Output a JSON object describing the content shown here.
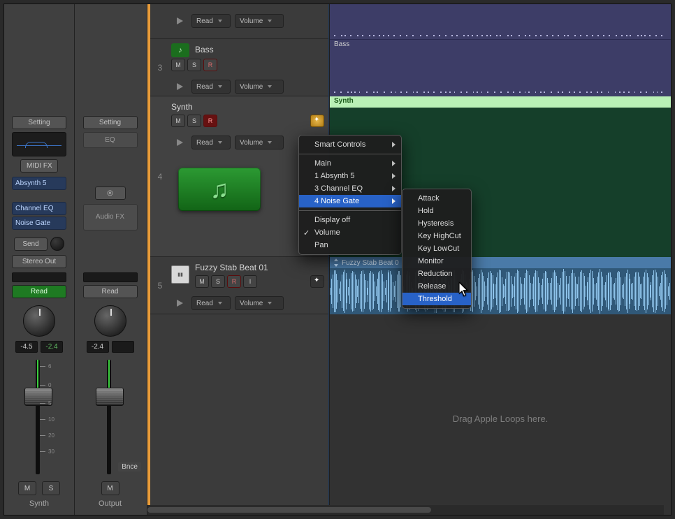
{
  "strips": [
    {
      "name": "Synth",
      "setting": "Setting",
      "midiFx": "MIDI FX",
      "instrument": "Absynth 5",
      "fx": [
        "Channel EQ",
        "Noise Gate"
      ],
      "send": "Send",
      "output": "Stereo Out",
      "read": "Read",
      "readOn": true,
      "db1": "-4.5",
      "db2": "-2.4",
      "ms": [
        "M",
        "S"
      ]
    },
    {
      "name": "Output",
      "setting": "Setting",
      "eqLabel": "EQ",
      "stereoSymbol": "◎",
      "audioFx": "Audio FX",
      "read": "Read",
      "readOn": false,
      "db1": "-2.4",
      "bnce": "Bnce",
      "ms": [
        "M"
      ]
    }
  ],
  "tracks": [
    {
      "num": "",
      "automation": {
        "read": "Read",
        "param": "Volume"
      }
    },
    {
      "num": "3",
      "title": "Bass",
      "msr": [
        "M",
        "S",
        "R"
      ],
      "automation": {
        "read": "Read",
        "param": "Volume"
      }
    },
    {
      "num": "4",
      "title": "Synth",
      "msr": [
        "M",
        "S",
        "R"
      ],
      "freeze": true,
      "automation": {
        "read": "Read",
        "param": "Volume"
      }
    },
    {
      "num": "5",
      "title": "Fuzzy Stab Beat 01",
      "msr": [
        "M",
        "S",
        "R",
        "I"
      ],
      "automation": {
        "read": "Read",
        "param": "Volume"
      }
    }
  ],
  "regions": {
    "bass": "Bass",
    "synth": "Synth",
    "audio": "Fuzzy Stab Beat 0"
  },
  "emptyMsg": "Drag Apple Loops here.",
  "menu1": {
    "smart": "Smart Controls",
    "main": "Main",
    "p1": "1 Absynth 5",
    "p3": "3 Channel EQ",
    "p4": "4 Noise Gate",
    "displayOff": "Display off",
    "volume": "Volume",
    "pan": "Pan"
  },
  "menu2": [
    "Attack",
    "Hold",
    "Hysteresis",
    "Key HighCut",
    "Key LowCut",
    "Monitor",
    "Reduction",
    "Release",
    "Threshold"
  ]
}
